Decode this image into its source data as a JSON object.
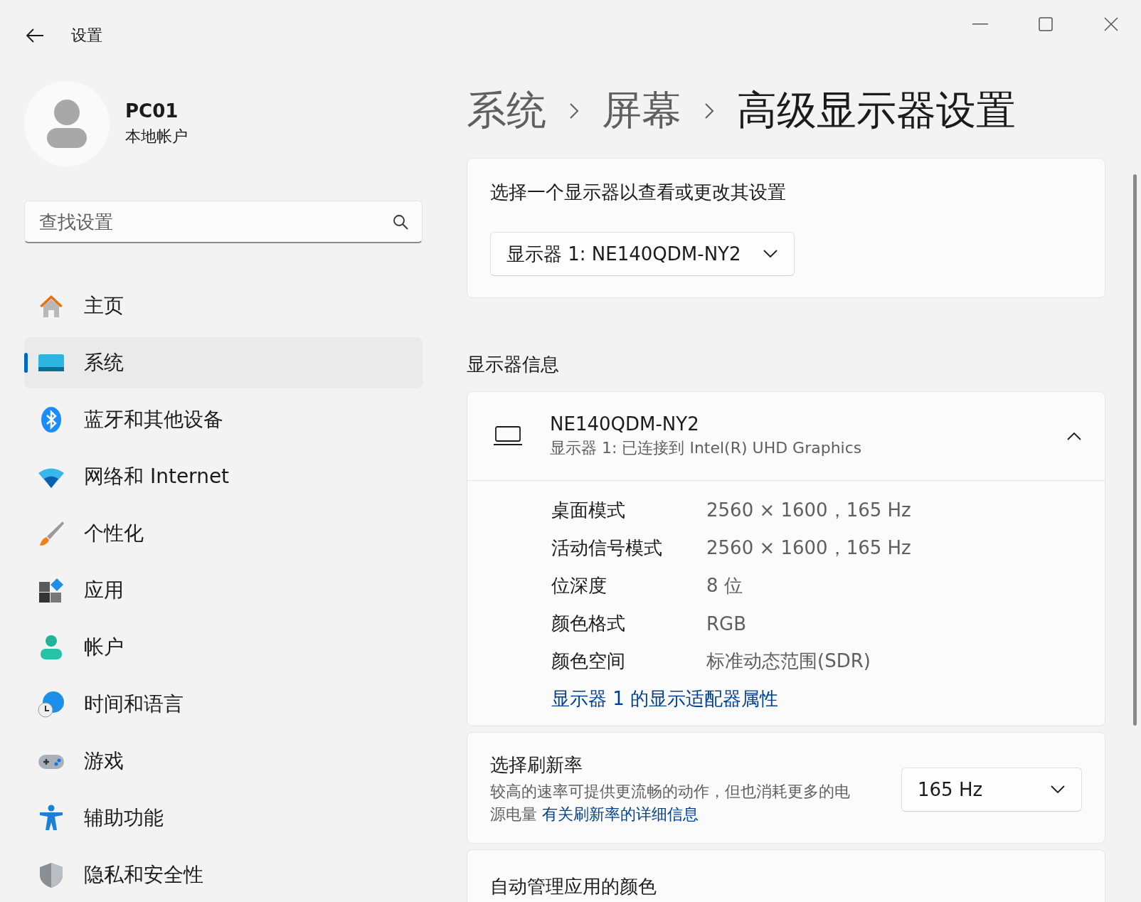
{
  "window": {
    "title": "设置"
  },
  "account": {
    "name": "PC01",
    "type": "本地帐户"
  },
  "search": {
    "placeholder": "查找设置"
  },
  "nav": [
    {
      "label": "主页",
      "selected": false
    },
    {
      "label": "系统",
      "selected": true
    },
    {
      "label": "蓝牙和其他设备",
      "selected": false
    },
    {
      "label": "网络和 Internet",
      "selected": false
    },
    {
      "label": "个性化",
      "selected": false
    },
    {
      "label": "应用",
      "selected": false
    },
    {
      "label": "帐户",
      "selected": false
    },
    {
      "label": "时间和语言",
      "selected": false
    },
    {
      "label": "游戏",
      "selected": false
    },
    {
      "label": "辅助功能",
      "selected": false
    },
    {
      "label": "隐私和安全性",
      "selected": false
    }
  ],
  "breadcrumb": [
    "系统",
    "屏幕",
    "高级显示器设置"
  ],
  "select_display": {
    "title": "选择一个显示器以查看或更改其设置",
    "value": "显示器 1: NE140QDM-NY2"
  },
  "display_info": {
    "heading": "显示器信息",
    "name": "NE140QDM-NY2",
    "subtitle": "显示器 1: 已连接到 Intel(R) UHD Graphics",
    "expanded": true,
    "rows": [
      {
        "label": "桌面模式",
        "value": "2560 × 1600，165 Hz"
      },
      {
        "label": "活动信号模式",
        "value": "2560 × 1600，165 Hz"
      },
      {
        "label": "位深度",
        "value": "8 位"
      },
      {
        "label": "颜色格式",
        "value": "RGB"
      },
      {
        "label": "颜色空间",
        "value": "标准动态范围(SDR)"
      }
    ],
    "link": "显示器 1 的显示适配器属性"
  },
  "refresh_rate": {
    "title": "选择刷新率",
    "description": "较高的速率可提供更流畅的动作，但也消耗更多的电源电量",
    "link": "有关刷新率的详细信息",
    "value": "165 Hz"
  },
  "auto_color": {
    "title": "自动管理应用的颜色"
  }
}
